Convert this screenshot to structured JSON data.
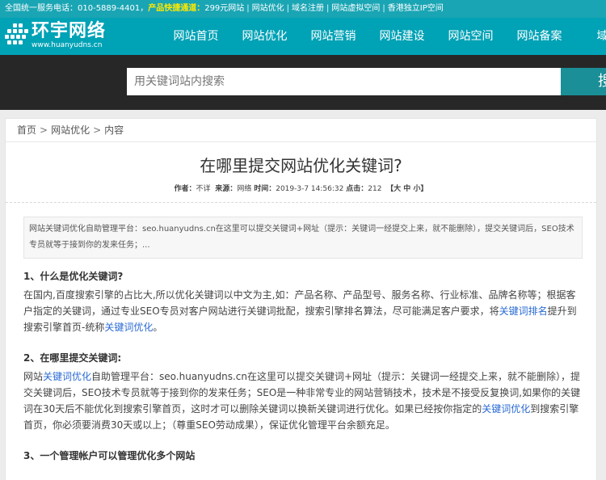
{
  "topbar": {
    "hotline": "全国统一服务电话：010-5889-4401，",
    "fast_label": "产品快捷通道：",
    "links": [
      "299元网站",
      "网站优化",
      "域名注册",
      "网站虚拟空间",
      "香港独立IP空间"
    ]
  },
  "logo": {
    "name": "环宇网络",
    "url": "www.huanyudns.cn"
  },
  "nav": {
    "items": [
      "网站首页",
      "网站优化",
      "网站营销",
      "网站建设",
      "网站空间",
      "网站备案",
      "域名"
    ]
  },
  "search": {
    "placeholder": "用关键词站内搜索",
    "button_label": "搜"
  },
  "breadcrumb": {
    "items": [
      "首页",
      "网站优化",
      "内容"
    ],
    "separator": ">"
  },
  "article": {
    "title": "在哪里提交网站优化关键词?",
    "meta": {
      "author_label": "作者：",
      "author": "不详",
      "source_label": "来源：",
      "source": "网络",
      "time_label": "时间：",
      "time": "2019-3-7 14:56:32",
      "clicks_label": "点击：",
      "clicks": "212",
      "font_size_label": "【大 中 小】"
    },
    "summary": "网站关键词优化自助管理平台：seo.huanyudns.cn在这里可以提交关键词+网址（提示：关键词一经提交上来，就不能删除），提交关键词后，SEO技术专员就等于接到你的发来任务；...",
    "s1": {
      "heading": "1、什么是优化关键词?",
      "text_a": "在国内,百度搜索引擎的占比大,所以优化关键词以中文为主,如：产品名称、产品型号、服务名称、行业标准、品牌名称等；根据客户指定的关键词，通过专业SEO专员对客户网站进行关键词批配，搜索引擎排名算法，尽可能满足客户要求，将",
      "link_a": "关键词排名",
      "text_b": "提升到搜索引擎首页-统称",
      "link_b": "关键词优化",
      "text_c": "。"
    },
    "s2": {
      "heading": "2、在哪里提交关键词:",
      "text_a": "网站",
      "link_a": "关键词优化",
      "text_b": "自助管理平台：seo.huanyudns.cn在这里可以提交关键词+网址（提示：关键词一经提交上来，就不能删除），提交关键词后，SEO技术专员就等于接到你的发来任务；SEO是一种非常专业的网站营销技术，技术是不接受反复换词,如果你的关键词在30天后不能优化到搜索引擎首页，这时才可以删除关键词以换新关键词进行优化。如果已经按你指定的",
      "link_b": "关键词优化",
      "text_c": "到搜索引擎首页，你必须要消费30天或以上；（尊重SEO劳动成果），保证优化管理平台余额充足。"
    },
    "s3": {
      "heading": "3、一个管理帐户可以管理优化多个网站"
    }
  }
}
